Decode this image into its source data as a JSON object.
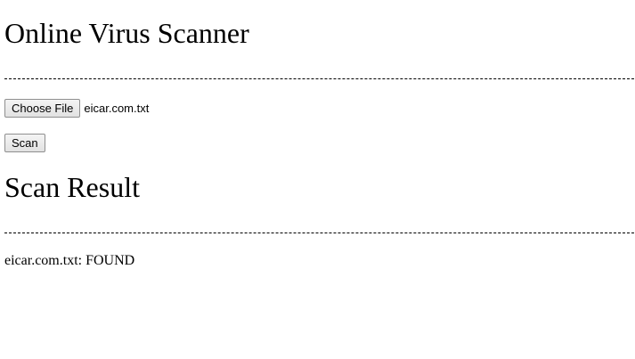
{
  "header": {
    "title": "Online Virus Scanner"
  },
  "upload": {
    "choose_file_label": "Choose File",
    "selected_file": "eicar.com.txt",
    "scan_label": "Scan"
  },
  "result": {
    "title": "Scan Result",
    "line": "eicar.com.txt: FOUND"
  }
}
